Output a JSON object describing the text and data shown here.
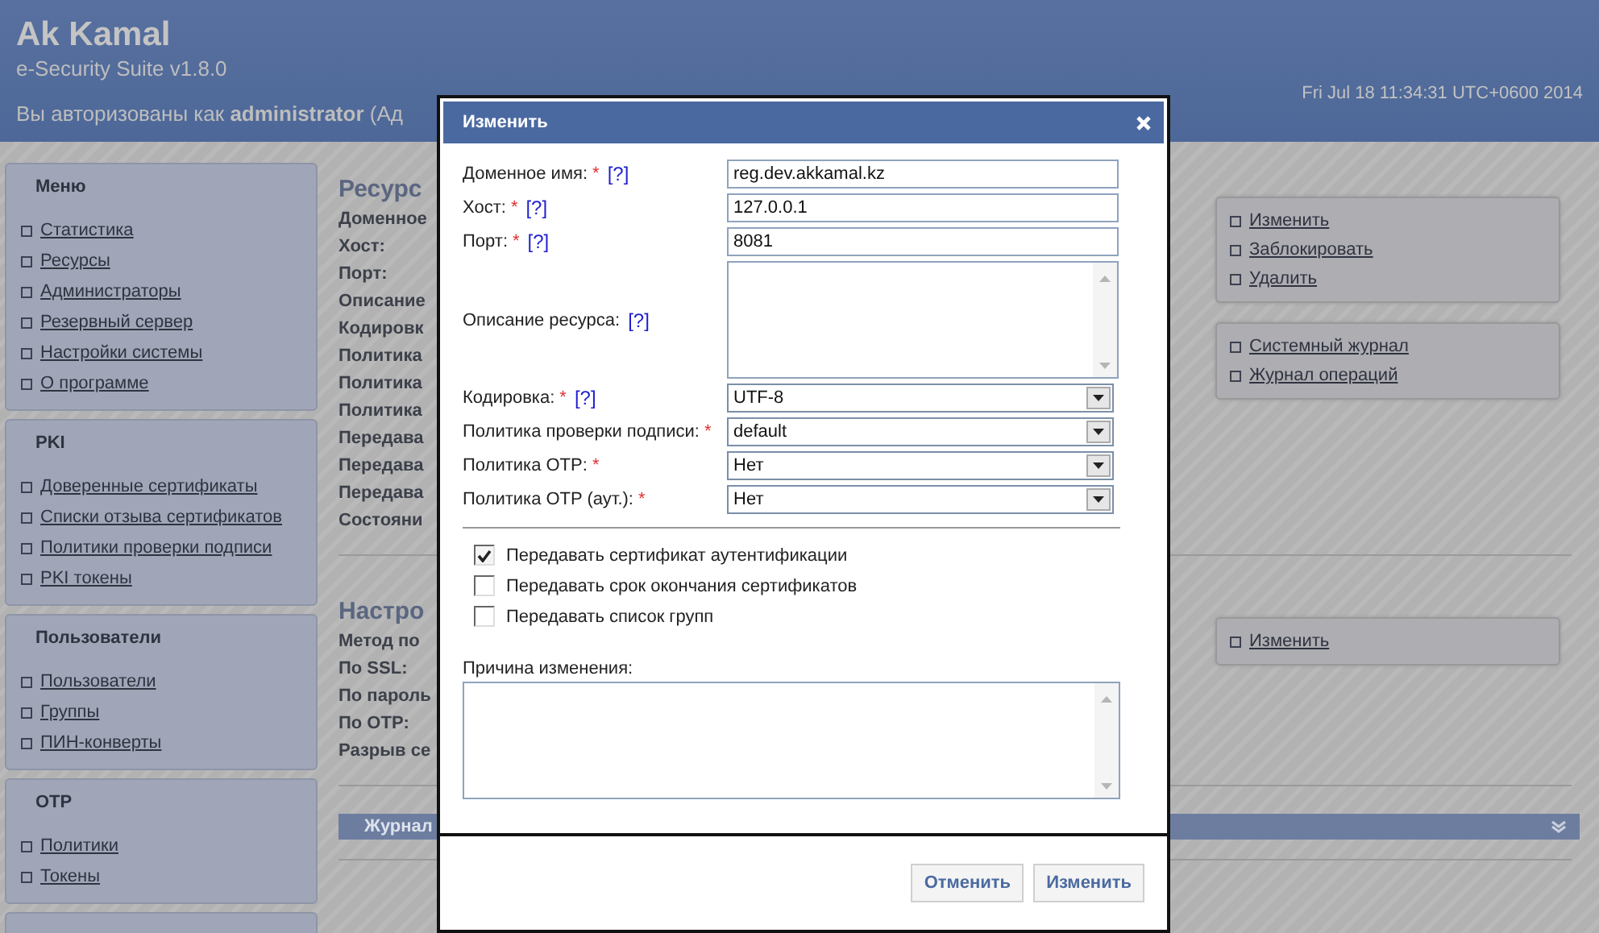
{
  "header": {
    "title": "Ak Kamal",
    "subtitle": "e-Security Suite v1.8.0",
    "login_text": "Вы авторизованы как **administrator** (Ад",
    "datetime": "Fri Jul 18 11:34:31 UTC+0600 2014"
  },
  "sidebar": [
    {
      "title": "Меню",
      "items": [
        "Статистика",
        "Ресурсы",
        "Администраторы",
        "Резервный сервер",
        "Настройки системы",
        "О программе"
      ]
    },
    {
      "title": "PKI",
      "items": [
        "Доверенные сертификаты",
        "Списки отзыва сертификатов",
        "Политики проверки подписи",
        "PKI токены"
      ]
    },
    {
      "title": "Пользователи",
      "items": [
        "Пользователи",
        "Группы",
        "ПИН-конверты"
      ]
    },
    {
      "title": "OTP",
      "items": [
        "Политики",
        "Токены"
      ]
    }
  ],
  "sections": [
    {
      "heading": "Ресурс",
      "rows": [
        "Доменное",
        "Хост:",
        "Порт:",
        "Описание",
        "Кодировк",
        "Политика",
        "Политика",
        "Политика",
        "Передава",
        "Передава",
        "Передава",
        "Состояни"
      ],
      "actions": [
        [
          "Изменить",
          "Заблокировать",
          "Удалить"
        ],
        [
          "Системный журнал",
          "Журнал операций"
        ]
      ]
    },
    {
      "heading": "Настро",
      "rows": [
        "Метод по",
        "По SSL:",
        "По пароль",
        "По OTP:",
        "Разрыв се"
      ],
      "actions": [
        [
          "Изменить"
        ]
      ]
    }
  ],
  "journal_bar": {
    "label": "Журнал"
  },
  "dialog": {
    "title": "Изменить",
    "fields": [
      {
        "kind": "text",
        "label": "Доменное имя:",
        "required_mark": "*",
        "help": "[?]",
        "value": "reg.dev.akkamal.kz"
      },
      {
        "kind": "text",
        "label": "Хост:",
        "required_mark": "*",
        "help": "[?]",
        "value": "127.0.0.1"
      },
      {
        "kind": "text",
        "label": "Порт:",
        "required_mark": "*",
        "help": "[?]",
        "value": "8081"
      },
      {
        "kind": "textarea",
        "label": "Описание ресурса:",
        "help": "[?]"
      },
      {
        "kind": "select",
        "label": "Кодировка:",
        "required_mark": "*",
        "help": "[?]",
        "value": "UTF-8"
      },
      {
        "kind": "select",
        "label": "Политика проверки подписи:",
        "required_mark": "*",
        "value": "default"
      },
      {
        "kind": "select",
        "label": "Политика OTP:",
        "required_mark": "*",
        "value": "Нет"
      },
      {
        "kind": "select",
        "label": "Политика OTP (аут.):",
        "required_mark": "*",
        "value": "Нет"
      }
    ],
    "checkboxes": [
      {
        "label": "Передавать сертификат аутентификации",
        "checked": true
      },
      {
        "label": "Передавать срок окончания сертификатов",
        "checked": false
      },
      {
        "label": "Передавать список групп",
        "checked": false
      }
    ],
    "reason": {
      "label": "Причина изменения:"
    },
    "buttons": [
      "Отменить",
      "Изменить"
    ]
  }
}
